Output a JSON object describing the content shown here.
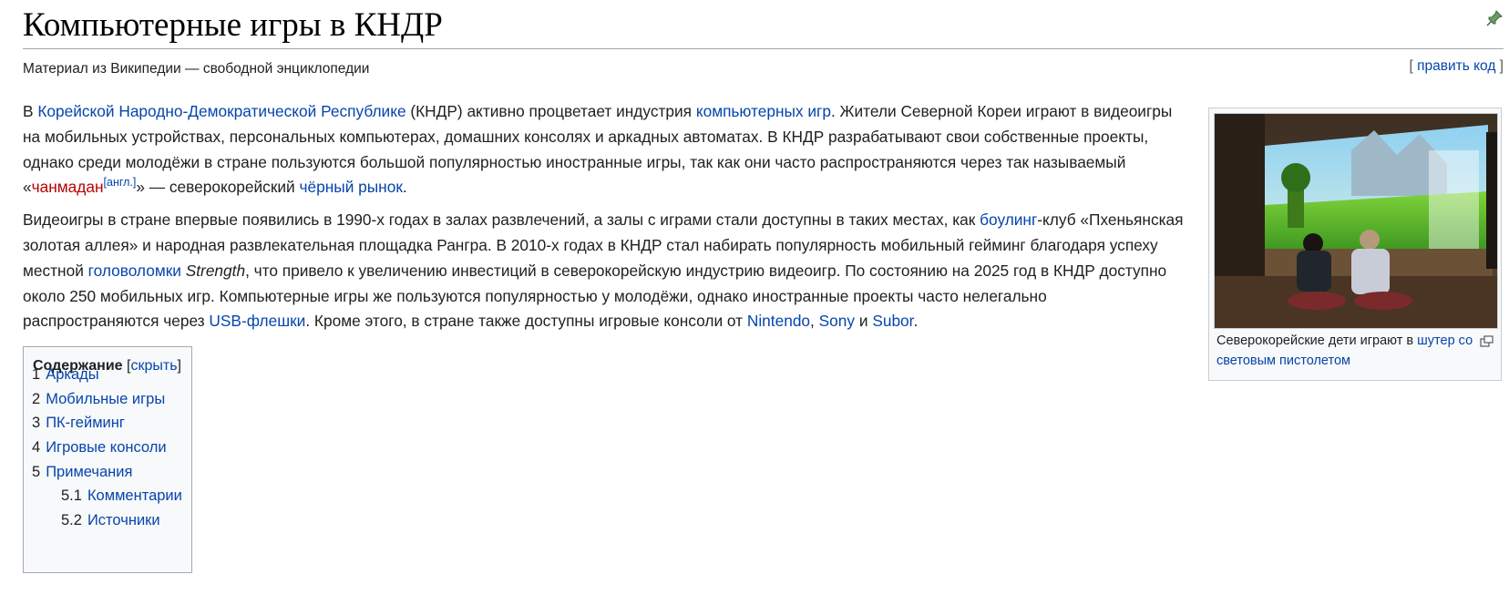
{
  "page": {
    "title": "Компьютерные игры в КНДР",
    "tagline": "Материал из Википедии — свободной энциклопедии",
    "edit_open": "[ ",
    "edit_label": "править код",
    "edit_close": " ]"
  },
  "paragraph1": {
    "t1": "В ",
    "l1": "Корейской Народно-Демократической Республике",
    "t2": " (КНДР) активно процветает индустрия ",
    "l2": "компьютерных игр",
    "t3": ". Жители Северной Кореи играют в видеоигры на мобильных устройствах, персональных компьютерах, домашних консолях и аркадных автоматах. В КНДР разрабатывают свои собственные проекты, однако среди молодёжи в стране пользуются большой популярностью иностранные игры, так как они часто распространяются через так называемый «",
    "l3": "чанмадан",
    "sup": "[англ.]",
    "t4": "» — северокорейский ",
    "l4": "чёрный рынок",
    "t5": "."
  },
  "paragraph2": {
    "t1": "Видеоигры в стране впервые появились в 1990-х годах в залах развлечений, а залы с играми стали доступны в таких местах, как ",
    "l1": "боулинг",
    "t2": "-клуб «Пхеньянская золотая аллея» и народная развлекательная площадка Рангра. В 2010-х годах в КНДР стал набирать популярность мобильный гейминг благодаря успеху местной ",
    "l2": "головоломки",
    "t3": " ",
    "em": "Strength",
    "t4": ", что привело к увеличению инвестиций в северокорейскую индустрию видеоигр. По состоянию на 2025 год в КНДР доступно около 250 мобильных игр. Компьютерные игры же пользуются популярностью у молодёжи, однако иностранные проекты часто нелегально распространяются через ",
    "l3": "USB-флешки",
    "t5": ". Кроме этого, в стране также доступны игровые консоли от ",
    "l4": "Nintendo",
    "t6": ", ",
    "l5": "Sony",
    "t7": " и ",
    "l6": "Subor",
    "t8": "."
  },
  "thumb": {
    "caption_text": "Северокорейские дети играют в ",
    "caption_link": "шутер со световым пистолетом"
  },
  "toc": {
    "title": "Содержание",
    "toggle_open": " [",
    "toggle": "скрыть",
    "toggle_close": "]",
    "items": [
      {
        "num": "1",
        "label": "Аркады"
      },
      {
        "num": "2",
        "label": "Мобильные игры"
      },
      {
        "num": "3",
        "label": "ПК-гейминг"
      },
      {
        "num": "4",
        "label": "Игровые консоли"
      },
      {
        "num": "5",
        "label": "Примечания"
      },
      {
        "num": "5.1",
        "label": "Комментарии"
      },
      {
        "num": "5.2",
        "label": "Источники"
      }
    ]
  },
  "colors": {
    "link": "#0645ad",
    "redlink": "#ba0000",
    "text": "#202122",
    "border": "#a2a9b1"
  },
  "icons": [
    "pushpin-icon",
    "magnify-icon"
  ]
}
